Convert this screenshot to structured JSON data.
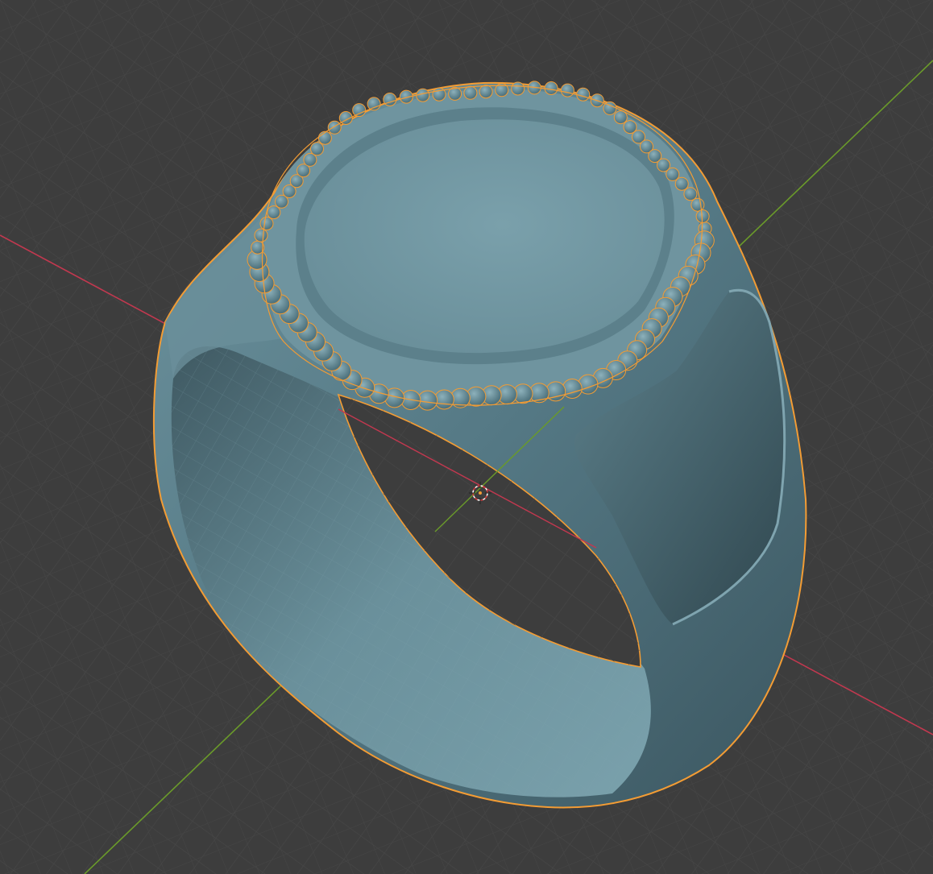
{
  "viewport": {
    "background_color": "#3d3d3d",
    "grid_color": "#4a4a4a",
    "x_axis_color": "#c2384f",
    "y_axis_color": "#6a9a2a"
  },
  "scene": {
    "object_type": "signet ring",
    "object_color": "#6e919c",
    "selection_outline_color": "#f39c34",
    "beads_on_bezel": true,
    "cursor_icon": "3d-cursor-icon"
  }
}
